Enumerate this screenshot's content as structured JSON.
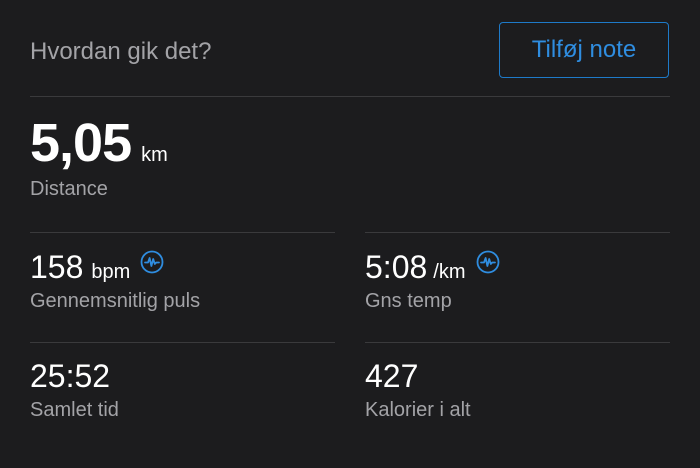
{
  "header": {
    "question": "Hvordan gik det?",
    "add_note_label": "Tilføj note"
  },
  "distance": {
    "value": "5,05",
    "unit": "km",
    "label": "Distance"
  },
  "heart_rate": {
    "value": "158",
    "unit": "bpm",
    "label": "Gennemsnitlig puls",
    "icon": "heart-rate-zone-icon"
  },
  "pace": {
    "value": "5:08",
    "unit": "/km",
    "label": "Gns temp",
    "icon": "heart-rate-zone-icon"
  },
  "total_time": {
    "value": "25:52",
    "label": "Samlet tid"
  },
  "calories": {
    "value": "427",
    "label": "Kalorier i alt"
  },
  "colors": {
    "background": "#1c1c1e",
    "accent": "#2f8de0",
    "secondary_text": "#a3a3a7",
    "divider": "#3a3a3c"
  }
}
